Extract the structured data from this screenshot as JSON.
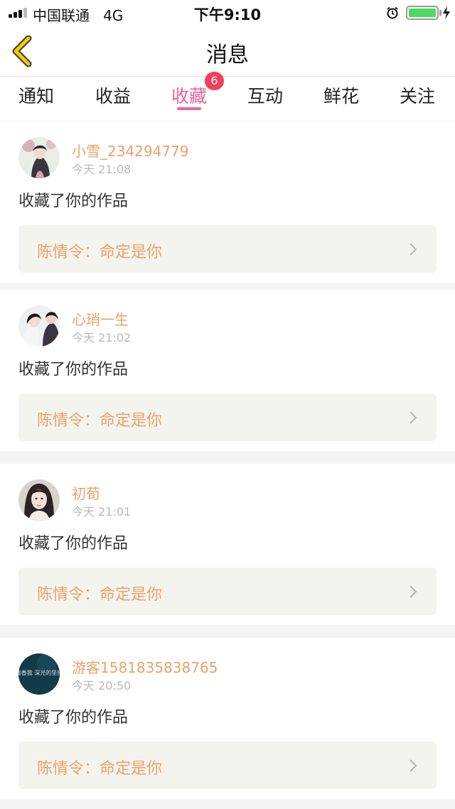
{
  "status_bar": {
    "carrier": "中国联通",
    "network": "4G",
    "time": "下午9:10",
    "battery_level": 1.0
  },
  "header": {
    "title": "消息"
  },
  "tabs": [
    {
      "label": "通知"
    },
    {
      "label": "收益"
    },
    {
      "label": "收藏",
      "active": true,
      "badge": "6"
    },
    {
      "label": "互动"
    },
    {
      "label": "鲜花"
    },
    {
      "label": "关注"
    }
  ],
  "messages": [
    {
      "user": "小雪_234294779",
      "time": "今天 21:08",
      "action": "收藏了你的作品",
      "work": "陈情令：命定是你"
    },
    {
      "user": "心琑一生",
      "time": "今天 21:02",
      "action": "收藏了你的作品",
      "work": "陈情令：命定是你"
    },
    {
      "user": "初荀",
      "time": "今天 21:01",
      "action": "收藏了你的作品",
      "work": "陈情令：命定是你"
    },
    {
      "user": "游客1581835838765",
      "time": "今天 20:50",
      "action": "收藏了你的作品",
      "work": "陈情令：命定是你"
    }
  ],
  "avatar4_text": "清香我 深光的坚持",
  "colors": {
    "accent": "#e8649a",
    "username": "#e9a26c",
    "badge": "#f2405a",
    "back_arrow": "#f5c800"
  }
}
